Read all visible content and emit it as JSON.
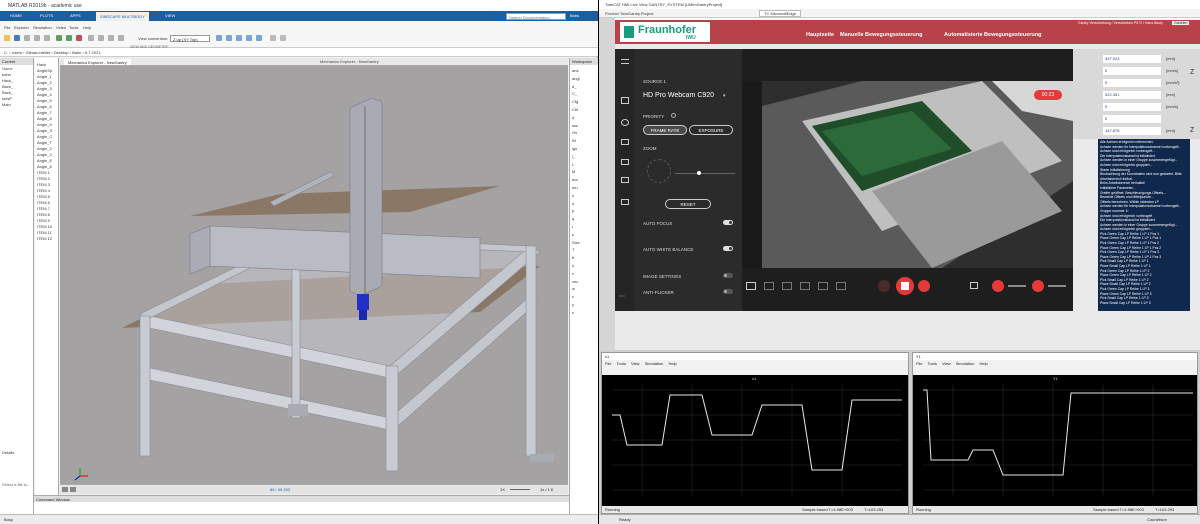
{
  "matlab": {
    "title": "MATLAB R2019b - academic use",
    "tabs": [
      "HOME",
      "PLOTS",
      "APPS",
      "SIMSCAPE MULTIBODY",
      "VIEW"
    ],
    "active_tab": "SIMSCAPE MULTIBODY",
    "search_placeholder": "Search Documentation",
    "user": "Bobs",
    "toolbar": {
      "items": [
        "File",
        "Explorer",
        "Simulation",
        "Video",
        "Tools",
        "Help"
      ],
      "view_convention": "View convention:",
      "view_value": "Z up (XY Top)",
      "section": "VIEW AND GEOMETRY"
    },
    "address": [
      "C:",
      "Users",
      "Gilmar.mteller",
      "Desktop",
      "Bahn",
      "6.7.2021"
    ],
    "left_panel": {
      "title": "Current",
      "header": "Name",
      "files": [
        "bahn",
        "Hack_",
        "Back_",
        "Back_",
        "sufsP",
        "Main"
      ],
      "details": "Details",
      "select_file": "Select a file to..."
    },
    "tree": {
      "items": [
        "Hack",
        "AngleSp",
        "Angle_1",
        "Angle_2",
        "Angle_3",
        "Angle_4",
        "Angle_5",
        "Angle_6",
        "Angle_7",
        "Angle_8",
        "Angle_9",
        "Angle_S",
        "Angle_C",
        "Angle_T",
        "Angle_2",
        "Angle_3",
        "Angle_E",
        "Angle_6",
        "ITEM 1",
        "ITEM 2",
        "ITEM 3",
        "ITEM 4",
        "ITEM 5",
        "ITEM 6",
        "ITEM 7",
        "ITEM 8",
        "ITEM 9",
        "ITEM 10",
        "ITEM 11",
        "ITEM 12"
      ]
    },
    "doc_tab": "Mechanics Explorer - NewGantry",
    "viewer_title": "Mechanics Explorer - NewGantry",
    "viewer_time": "85 / 35.303",
    "viewer_speed": "1X",
    "viewer_step": "1x / 1.6",
    "workspace": {
      "title": "Workspace",
      "items": [
        "ans",
        "angl",
        "d_",
        "C_",
        "Cfg",
        "Ctrl",
        "d",
        "sss",
        "Gs",
        "IN",
        "lgs",
        "l_",
        "L",
        "M",
        "ma",
        "mu",
        "n",
        "o",
        "p",
        "q",
        "r",
        "s",
        "Size",
        "T",
        "tt",
        "u",
        "v",
        "vec",
        "w",
        "x",
        "y",
        "z"
      ]
    },
    "command_window": "Command Window",
    "status": "Busy"
  },
  "desktop_viewer": {
    "title": "TwinCAT HMI Live View GANTRY_SYSTEM [UMImGantryProject]",
    "menu": "Product  TwinGantry.Project",
    "tab": "TC MicrosoftEdge"
  },
  "hmi": {
    "brand": "Fraunhofer",
    "brand_sub": "IWU",
    "nav": [
      "Hauptseite",
      "Manuelle Bewegungssteuerung",
      "Automatisierte Bewegungssteuerung"
    ],
    "user_line": "Gantry Verschiebung / Verschieben P072 / Hans Bauly",
    "logout": "Gantrien"
  },
  "camera_app": {
    "source_label": "SOURCE 1",
    "source_value": "HD Pro Webcam C920",
    "priority_label": "PRIORITY",
    "priority_options": [
      "FRAME RATE",
      "EXPOSURE"
    ],
    "zoom_label": "ZOOM",
    "reset_label": "RESET",
    "auto_focus": "AUTO FOCUS",
    "auto_white_balance": "AUTO WHITE BALANCE",
    "image_settings": "IMAGE SETTINGS",
    "anti_flicker": "ANTI-FLICKER",
    "recording_time": "00:23",
    "auto_focus_on": true,
    "auto_white_balance_on": true,
    "image_settings_on": false,
    "anti_flicker_on": false,
    "zoom_level": 0.4
  },
  "side_fields": [
    {
      "value": "397.023",
      "unit": "[mm]"
    },
    {
      "value": "0",
      "unit": "[mm/s]"
    },
    {
      "value": "0",
      "unit": "[mm/s²]"
    },
    {
      "value": "522.351",
      "unit": "[mm]"
    },
    {
      "value": "0",
      "unit": "[mm/s]"
    },
    {
      "value": "0",
      "unit": ""
    },
    {
      "value": "167.876",
      "unit": "[mm]"
    }
  ],
  "side_labels": [
    "Z",
    "Z"
  ],
  "log_lines": [
    "Alle Achsen erfolgreich referenziert.",
    "Achsen werden für Interpolationschannel vorbeugeft...",
    "Achsen sind erfolgreich vorbeugeft...",
    "Die Interpolationskanal ist initialisiert.",
    "Achsen werden in einer Gruppe zusammengefügt...",
    "Achsen sind erfolgreich gruppiert...",
    "Starte Initialisierung",
    "Beobachtung der Koordinaten wird nun gestartet. Bitte",
    "Arbeitsbereich freihal.",
    "Beim Arbeitsbereich freihaltet!",
    "Initialisiere Parameter...",
    "Greifer geöffnet. Beschleunigungs-Offsets...",
    "Bewerbe Offsets und Mittelpunkte...",
    "Offsets berechnen. Wähle nächsten LP",
    "Achsen werden für Interpolationschannel vorbeugeft...",
    "Gruppe nummer 1!",
    "Achsen sind erfolgreich vorbeugeft",
    "Die Interpolationskanal ist initialisiert.",
    "Achsen werden in einer Gruppe zusammengefügt...",
    "Achsen sind erfolgreich gruppiert...",
    "Pick Green Cap LP Reihe 1 LP 1 Pos 1",
    "Place Green Cap LP Reihe 1 LP 1 Pos 1",
    "Pick Green Cap LP Reihe 1 LP 1 Pos 2",
    "Place Green Cap LP Reihe 1 LP 1 Pos 2",
    "Pick Green Cap LP Reihe 1 LP 1 Pos 3",
    "Place Green Cap LP Reihe 1 LP 1 Pos 3",
    "Pick Small Cap LP Reihe 1 LP 1",
    "Place Small Cap LP Reihe 1 LP 1",
    "Pick Green Cap LP Reihe 1 LP 2",
    "Place Green Cap LP Reihe 1 LP 2",
    "Pick Small Cap LP Reihe 1 LP 2",
    "Place Small Cap LP Reihe 1 LP 2",
    "Pick Green Cap LP Reihe 1 LP 3",
    "Place Green Cap LP Reihe 1 LP 3",
    "Pick Small Cap LP Reihe 1 LP 3",
    "Place Small Cap LP Reihe 1 LP 3"
  ],
  "scopes": [
    {
      "title": "x1",
      "menu": [
        "File",
        "Tools",
        "View",
        "Simulation",
        "Help"
      ],
      "plot_title": "x1",
      "status_left": "Running",
      "status_right": "Sample based  T=4.98E+003",
      "status_time": "T=103.293",
      "color": "#e8e8e8"
    },
    {
      "title": "Y1",
      "menu": [
        "File",
        "Tools",
        "View",
        "Simulation",
        "Help"
      ],
      "plot_title": "Y1",
      "status_left": "Running",
      "status_right": "Sample based  T=4.98E+003",
      "status_time": "T=103.293",
      "color": "#e8e8e8"
    }
  ],
  "taskbar": {
    "left": "Ready",
    "right": "Count/eure"
  }
}
